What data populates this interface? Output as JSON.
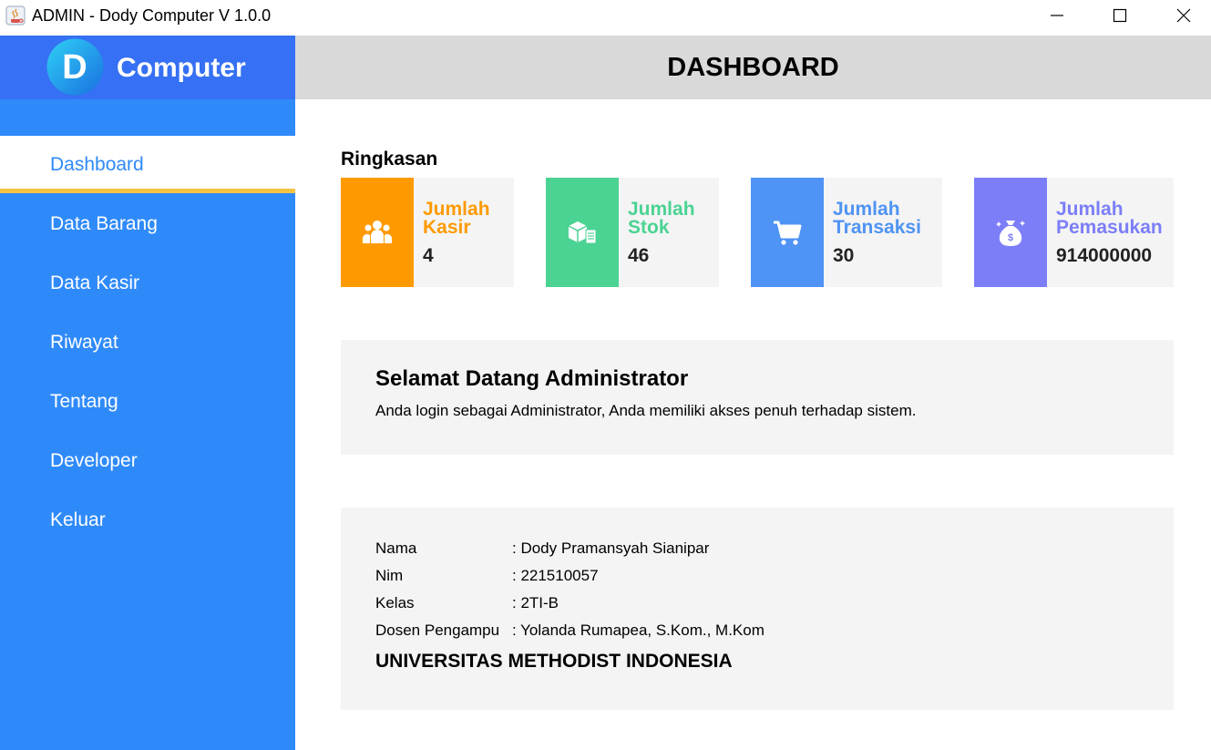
{
  "window": {
    "title": "ADMIN - Dody Computer V 1.0.0"
  },
  "brand": {
    "logo_letter": "D",
    "name": "Computer",
    "color": "#3670f4"
  },
  "sidebar": {
    "color": "#2f8af9",
    "active_indicator_color": "#f5c242",
    "items": [
      {
        "label": "Dashboard",
        "active": true
      },
      {
        "label": "Data Barang"
      },
      {
        "label": "Data Kasir"
      },
      {
        "label": "Riwayat"
      },
      {
        "label": "Tentang"
      },
      {
        "label": "Developer"
      },
      {
        "label": "Keluar"
      }
    ]
  },
  "header": {
    "title": "DASHBOARD"
  },
  "summary": {
    "label": "Ringkasan",
    "cards": [
      {
        "title_line1": "Jumlah",
        "title_line2": "Kasir",
        "value": "4",
        "color": "#fe9a00",
        "icon": "users-icon"
      },
      {
        "title_line1": "Jumlah",
        "title_line2": "Stok",
        "value": "46",
        "color": "#4bd393",
        "icon": "boxes-icon"
      },
      {
        "title_line1": "Jumlah",
        "title_line2": "Transaksi",
        "value": "30",
        "color": "#4f93f4",
        "icon": "cart-icon"
      },
      {
        "title_line1": "Jumlah",
        "title_line2": "Pemasukan",
        "value": "914000000",
        "color": "#7c7ef8",
        "icon": "money-bag-icon"
      }
    ]
  },
  "welcome": {
    "title": "Selamat Datang Administrator",
    "text": "Anda login sebagai Administrator, Anda memiliki akses penuh terhadap sistem."
  },
  "info": {
    "rows": [
      {
        "key": "Nama",
        "value": ": Dody Pramansyah Sianipar"
      },
      {
        "key": "Nim",
        "value": ": 221510057"
      },
      {
        "key": "Kelas",
        "value": ": 2TI-B"
      },
      {
        "key": "Dosen Pengampu",
        "value": ": Yolanda Rumapea, S.Kom., M.Kom"
      }
    ],
    "university": "UNIVERSITAS METHODIST INDONESIA"
  }
}
